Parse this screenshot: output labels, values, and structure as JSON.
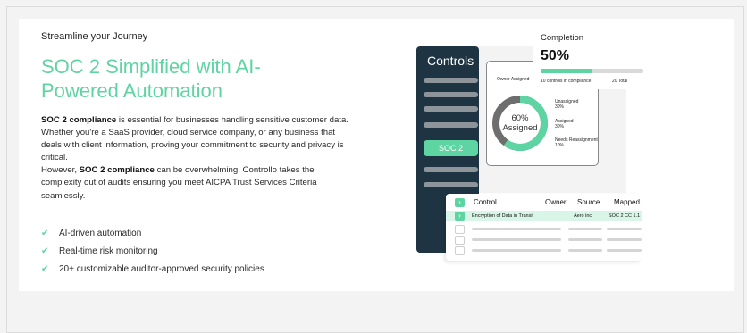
{
  "hero": {
    "eyebrow": "Streamline your Journey",
    "headline_line1": "SOC 2 Simplified with AI-",
    "headline_line2": "Powered Automation",
    "para1_bold": "SOC 2 compliance",
    "para1_rest": " is essential for businesses handling sensitive customer data. Whether you're a SaaS provider, cloud service company, or any business that deals with client information, proving your commitment to security and privacy is critical.",
    "para2_start": "However, ",
    "para2_bold": "SOC 2 compliance",
    "para2_rest": " can be overwhelming. Controllo takes the complexity out of audits ensuring you meet AICPA Trust Services Criteria seamlessly.",
    "features": [
      "AI-driven automation",
      "Real-time risk monitoring",
      "20+ customizable auditor-approved security policies"
    ]
  },
  "illustration": {
    "controls_title": "Controls",
    "controls_active": "SOC 2",
    "owner_label": "Owner Assigned",
    "donut": {
      "assigned_pct": 0.6,
      "center_value": "60%",
      "center_label": "Assigned",
      "legend": [
        {
          "label": "Unassigned",
          "value": "30%"
        },
        {
          "label": "Assigned",
          "value": "30%"
        },
        {
          "label": "Needs Reassignment",
          "value": "10%"
        }
      ]
    },
    "completion": {
      "title": "Completion",
      "value": "50%",
      "fill": 0.5,
      "footer": "10 controls in compliance",
      "total": "20 Total"
    },
    "table": {
      "headers": {
        "control": "Control",
        "owner": "Owner",
        "source": "Source",
        "mapped": "Mapped"
      },
      "row": {
        "control": "Encryption of Data in Transit",
        "owner": "Aero inc",
        "mapped": "SOC 2 CC 1.1"
      }
    }
  },
  "colors": {
    "accent": "#5ed4a2",
    "navy": "#1f3442",
    "row_highlight": "#d8f5e8"
  }
}
